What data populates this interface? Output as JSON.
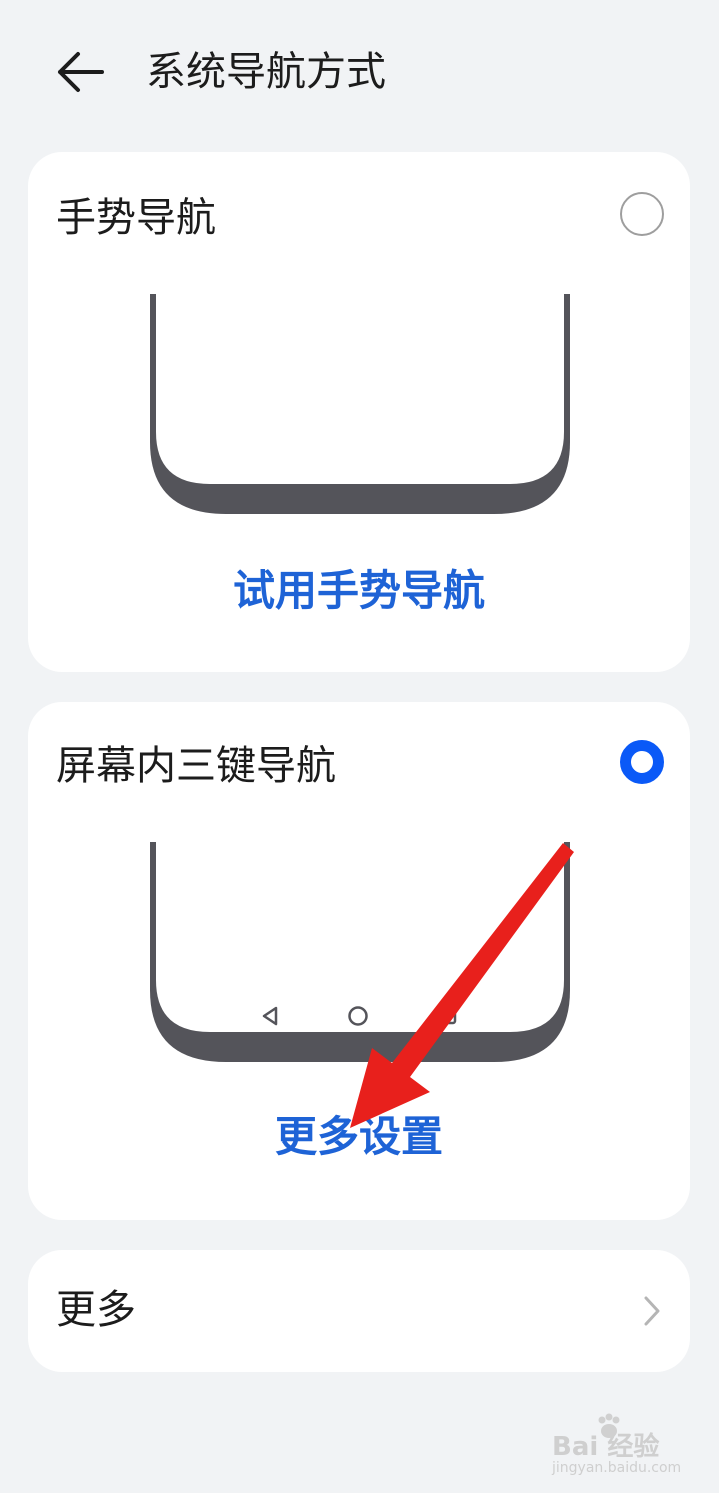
{
  "header": {
    "back_icon": "arrow-left-icon",
    "title": "系统导航方式"
  },
  "options": [
    {
      "title": "手势导航",
      "selected": false,
      "action_label": "试用手势导航"
    },
    {
      "title": "屏幕内三键导航",
      "selected": true,
      "action_label": "更多设置",
      "nav_icons": [
        "back-triangle-icon",
        "home-circle-icon",
        "recents-square-icon"
      ]
    }
  ],
  "more": {
    "label": "更多",
    "chevron_icon": "chevron-right-icon"
  },
  "annotation": {
    "arrow_color": "#e8201c"
  },
  "watermark": {
    "brand": "Bai  经验",
    "site": "jingyan.baidu.com"
  },
  "colors": {
    "accent": "#0a59f7",
    "link": "#1e63d6",
    "background": "#f1f3f5",
    "card": "#ffffff",
    "phone_frame": "#54545a"
  }
}
